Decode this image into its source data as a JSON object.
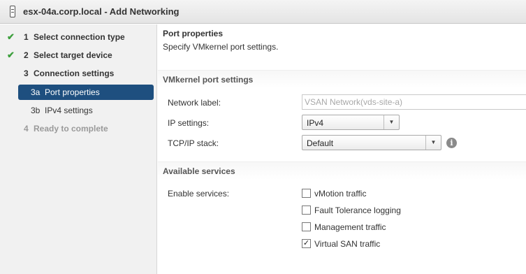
{
  "window": {
    "title": "esx-04a.corp.local - Add Networking"
  },
  "wizard": {
    "steps": [
      {
        "num": "1",
        "label": "Select connection type",
        "status": "complete"
      },
      {
        "num": "2",
        "label": "Select target device",
        "status": "complete"
      },
      {
        "num": "3",
        "label": "Connection settings",
        "status": "current"
      },
      {
        "num": "3a",
        "label": "Port properties",
        "status": "active"
      },
      {
        "num": "3b",
        "label": "IPv4 settings",
        "status": "pending"
      },
      {
        "num": "4",
        "label": "Ready to complete",
        "status": "disabled"
      }
    ],
    "check_glyph": "✔"
  },
  "page": {
    "title": "Port properties",
    "description": "Specify VMkernel port settings."
  },
  "vmkernel": {
    "section_title": "VMkernel port settings",
    "network_label": {
      "label": "Network label:",
      "value": "VSAN Network(vds-site-a)"
    },
    "ip_settings": {
      "label": "IP settings:",
      "value": "IPv4"
    },
    "tcpip_stack": {
      "label": "TCP/IP stack:",
      "value": "Default"
    },
    "info_glyph": "i",
    "arrow_glyph": "▼"
  },
  "services": {
    "section_title": "Available services",
    "enable_label": "Enable services:",
    "items": [
      {
        "label": "vMotion traffic",
        "checked": false
      },
      {
        "label": "Fault Tolerance logging",
        "checked": false
      },
      {
        "label": "Management traffic",
        "checked": false
      },
      {
        "label": "Virtual SAN traffic",
        "checked": true
      }
    ],
    "check_glyph": "✓"
  }
}
